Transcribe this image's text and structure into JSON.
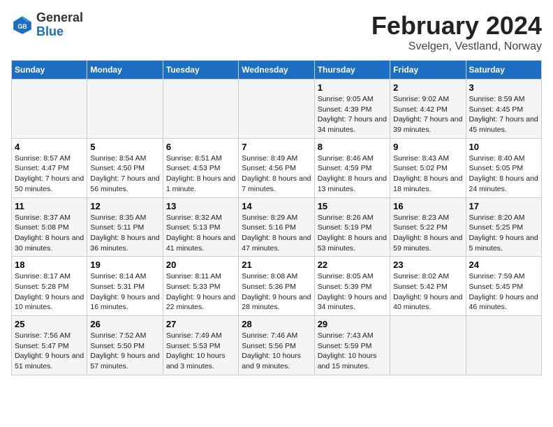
{
  "header": {
    "logo": {
      "text_general": "General",
      "text_blue": "Blue"
    },
    "title": "February 2024",
    "location": "Svelgen, Vestland, Norway"
  },
  "calendar": {
    "days_of_week": [
      "Sunday",
      "Monday",
      "Tuesday",
      "Wednesday",
      "Thursday",
      "Friday",
      "Saturday"
    ],
    "weeks": [
      [
        {
          "day": "",
          "info": ""
        },
        {
          "day": "",
          "info": ""
        },
        {
          "day": "",
          "info": ""
        },
        {
          "day": "",
          "info": ""
        },
        {
          "day": "1",
          "info": "Sunrise: 9:05 AM\nSunset: 4:39 PM\nDaylight: 7 hours\nand 34 minutes."
        },
        {
          "day": "2",
          "info": "Sunrise: 9:02 AM\nSunset: 4:42 PM\nDaylight: 7 hours\nand 39 minutes."
        },
        {
          "day": "3",
          "info": "Sunrise: 8:59 AM\nSunset: 4:45 PM\nDaylight: 7 hours\nand 45 minutes."
        }
      ],
      [
        {
          "day": "4",
          "info": "Sunrise: 8:57 AM\nSunset: 4:47 PM\nDaylight: 7 hours\nand 50 minutes."
        },
        {
          "day": "5",
          "info": "Sunrise: 8:54 AM\nSunset: 4:50 PM\nDaylight: 7 hours\nand 56 minutes."
        },
        {
          "day": "6",
          "info": "Sunrise: 8:51 AM\nSunset: 4:53 PM\nDaylight: 8 hours\nand 1 minute."
        },
        {
          "day": "7",
          "info": "Sunrise: 8:49 AM\nSunset: 4:56 PM\nDaylight: 8 hours\nand 7 minutes."
        },
        {
          "day": "8",
          "info": "Sunrise: 8:46 AM\nSunset: 4:59 PM\nDaylight: 8 hours\nand 13 minutes."
        },
        {
          "day": "9",
          "info": "Sunrise: 8:43 AM\nSunset: 5:02 PM\nDaylight: 8 hours\nand 18 minutes."
        },
        {
          "day": "10",
          "info": "Sunrise: 8:40 AM\nSunset: 5:05 PM\nDaylight: 8 hours\nand 24 minutes."
        }
      ],
      [
        {
          "day": "11",
          "info": "Sunrise: 8:37 AM\nSunset: 5:08 PM\nDaylight: 8 hours\nand 30 minutes."
        },
        {
          "day": "12",
          "info": "Sunrise: 8:35 AM\nSunset: 5:11 PM\nDaylight: 8 hours\nand 36 minutes."
        },
        {
          "day": "13",
          "info": "Sunrise: 8:32 AM\nSunset: 5:13 PM\nDaylight: 8 hours\nand 41 minutes."
        },
        {
          "day": "14",
          "info": "Sunrise: 8:29 AM\nSunset: 5:16 PM\nDaylight: 8 hours\nand 47 minutes."
        },
        {
          "day": "15",
          "info": "Sunrise: 8:26 AM\nSunset: 5:19 PM\nDaylight: 8 hours\nand 53 minutes."
        },
        {
          "day": "16",
          "info": "Sunrise: 8:23 AM\nSunset: 5:22 PM\nDaylight: 8 hours\nand 59 minutes."
        },
        {
          "day": "17",
          "info": "Sunrise: 8:20 AM\nSunset: 5:25 PM\nDaylight: 9 hours\nand 5 minutes."
        }
      ],
      [
        {
          "day": "18",
          "info": "Sunrise: 8:17 AM\nSunset: 5:28 PM\nDaylight: 9 hours\nand 10 minutes."
        },
        {
          "day": "19",
          "info": "Sunrise: 8:14 AM\nSunset: 5:31 PM\nDaylight: 9 hours\nand 16 minutes."
        },
        {
          "day": "20",
          "info": "Sunrise: 8:11 AM\nSunset: 5:33 PM\nDaylight: 9 hours\nand 22 minutes."
        },
        {
          "day": "21",
          "info": "Sunrise: 8:08 AM\nSunset: 5:36 PM\nDaylight: 9 hours\nand 28 minutes."
        },
        {
          "day": "22",
          "info": "Sunrise: 8:05 AM\nSunset: 5:39 PM\nDaylight: 9 hours\nand 34 minutes."
        },
        {
          "day": "23",
          "info": "Sunrise: 8:02 AM\nSunset: 5:42 PM\nDaylight: 9 hours\nand 40 minutes."
        },
        {
          "day": "24",
          "info": "Sunrise: 7:59 AM\nSunset: 5:45 PM\nDaylight: 9 hours\nand 46 minutes."
        }
      ],
      [
        {
          "day": "25",
          "info": "Sunrise: 7:56 AM\nSunset: 5:47 PM\nDaylight: 9 hours\nand 51 minutes."
        },
        {
          "day": "26",
          "info": "Sunrise: 7:52 AM\nSunset: 5:50 PM\nDaylight: 9 hours\nand 57 minutes."
        },
        {
          "day": "27",
          "info": "Sunrise: 7:49 AM\nSunset: 5:53 PM\nDaylight: 10 hours\nand 3 minutes."
        },
        {
          "day": "28",
          "info": "Sunrise: 7:46 AM\nSunset: 5:56 PM\nDaylight: 10 hours\nand 9 minutes."
        },
        {
          "day": "29",
          "info": "Sunrise: 7:43 AM\nSunset: 5:59 PM\nDaylight: 10 hours\nand 15 minutes."
        },
        {
          "day": "",
          "info": ""
        },
        {
          "day": "",
          "info": ""
        }
      ]
    ]
  }
}
